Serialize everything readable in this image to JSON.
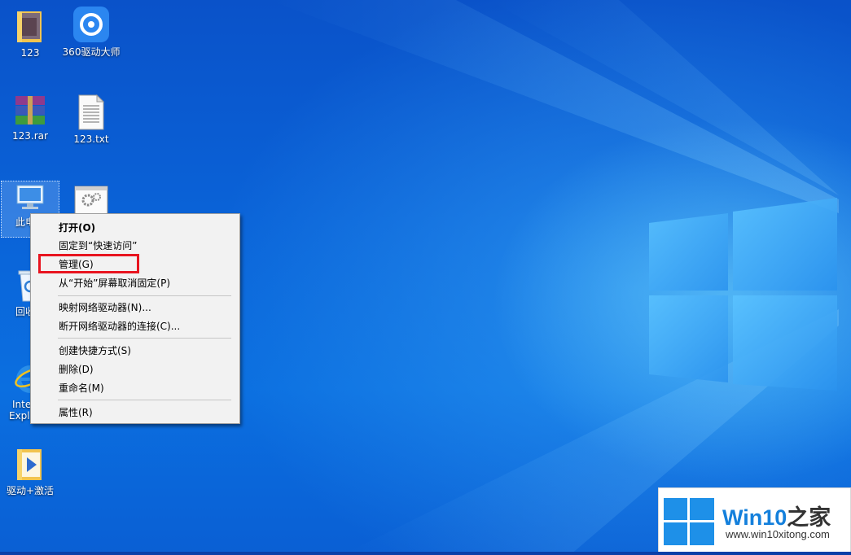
{
  "desktop": {
    "icons": [
      {
        "label": "123"
      },
      {
        "label": "360驱动大师"
      },
      {
        "label": "123.rar"
      },
      {
        "label": "123.txt"
      },
      {
        "label": "此电"
      },
      {
        "label": ""
      },
      {
        "label": "回收"
      },
      {
        "label": "Inte"
      },
      {
        "label": "Expl"
      },
      {
        "label": "驱动+激活"
      }
    ]
  },
  "context_menu": {
    "items": [
      {
        "label": "打开(O)"
      },
      {
        "label": "固定到“快速访问”"
      },
      {
        "label": "管理(G)"
      },
      {
        "label": "从“开始”屏幕取消固定(P)"
      },
      {
        "label": "映射网络驱动器(N)..."
      },
      {
        "label": "断开网络驱动器的连接(C)..."
      },
      {
        "label": "创建快捷方式(S)"
      },
      {
        "label": "删除(D)"
      },
      {
        "label": "重命名(M)"
      },
      {
        "label": "属性(R)"
      }
    ]
  },
  "watermark": {
    "title_prefix": "Win10",
    "title_suffix": "之家",
    "url": "www.win10xitong.com"
  },
  "colors": {
    "accent": "#1480dc",
    "highlight": "#e8141f",
    "desktop_bg": "#0a63d8"
  }
}
